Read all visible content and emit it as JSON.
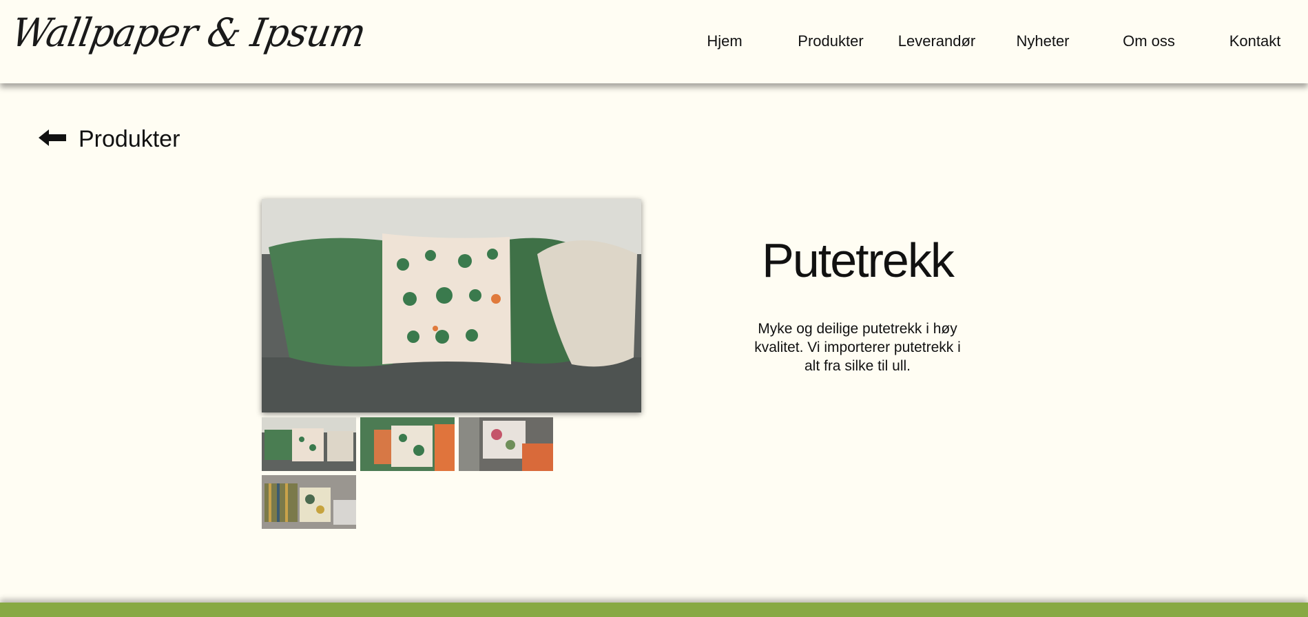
{
  "header": {
    "logo_text": "Wallpaper & Ipsum",
    "nav": [
      "Hjem",
      "Produkter",
      "Leverandør",
      "Nyheter",
      "Om oss",
      "Kontakt"
    ]
  },
  "back_link": {
    "label": "Produkter",
    "icon": "arrow-left-icon"
  },
  "product": {
    "title": "Putetrekk",
    "description": "Myke og deilige putetrekk i høy kvalitet. Vi importerer putetrekk i alt fra silke til ull."
  },
  "colors": {
    "background": "#fffdf3",
    "footer_accent": "#87a944"
  }
}
